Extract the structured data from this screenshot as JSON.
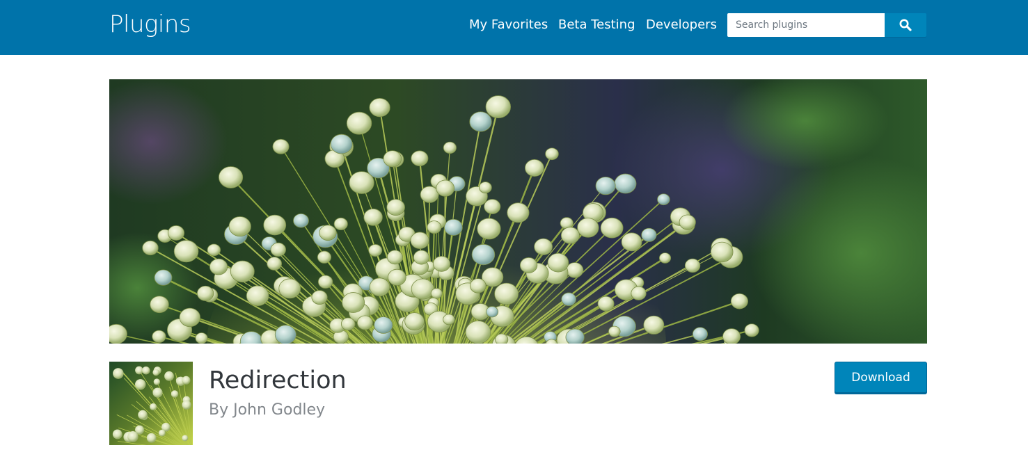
{
  "header": {
    "site_title": "Plugins",
    "nav": [
      {
        "label": "My Favorites"
      },
      {
        "label": "Beta Testing"
      },
      {
        "label": "Developers"
      }
    ],
    "search": {
      "placeholder": "Search plugins",
      "value": "",
      "button_icon": "search-icon"
    },
    "colors": {
      "header_bg": "#0073aa",
      "button_bg": "#0085ba"
    }
  },
  "plugin": {
    "banner_image": "allium-seed-head-photo",
    "icon_image": "allium-seed-head-photo",
    "name": "Redirection",
    "author": "By John Godley",
    "download_label": "Download"
  }
}
